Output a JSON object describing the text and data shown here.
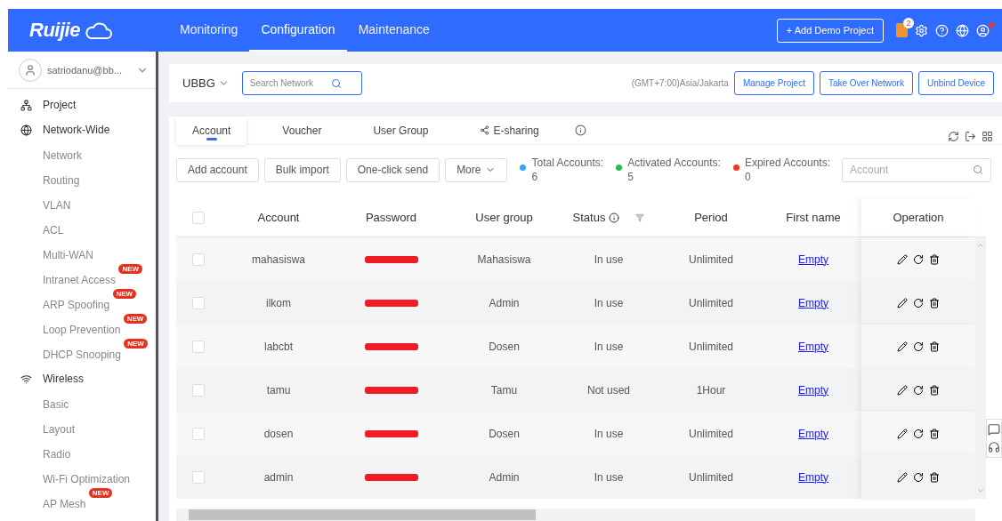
{
  "header": {
    "logo": "Ruijie",
    "nav": [
      {
        "label": "Monitoring",
        "selected": false
      },
      {
        "label": "Configuration",
        "selected": true
      },
      {
        "label": "Maintenance",
        "selected": false
      }
    ],
    "add_demo_button": "+ Add Demo Project",
    "alert_count": "2"
  },
  "user": {
    "name": "satriodanu@bb..."
  },
  "sidebar": {
    "items": [
      {
        "label": "Project",
        "kind": "project"
      },
      {
        "label": "Network-Wide",
        "kind": "globe",
        "children": [
          {
            "label": "Network"
          },
          {
            "label": "Routing"
          },
          {
            "label": "VLAN"
          },
          {
            "label": "ACL"
          },
          {
            "label": "Multi-WAN"
          },
          {
            "label": "Intranet Access",
            "badge": "NEW"
          },
          {
            "label": "ARP Spoofing",
            "badge": "NEW"
          },
          {
            "label": "Loop Prevention",
            "badge": "NEW"
          },
          {
            "label": "DHCP Snooping",
            "badge": "NEW"
          }
        ]
      },
      {
        "label": "Wireless",
        "kind": "wifi",
        "children": [
          {
            "label": "Basic"
          },
          {
            "label": "Layout"
          },
          {
            "label": "Radio"
          },
          {
            "label": "Wi-Fi Optimization"
          },
          {
            "label": "AP Mesh",
            "badge": "NEW"
          }
        ]
      }
    ]
  },
  "project_bar": {
    "network": "UBBG",
    "search": {
      "placeholder": "Search Network"
    },
    "timezone": "(GMT+7:00)Asia/Jakarta",
    "buttons": [
      "Manage Project",
      "Take Over Network",
      "Unbind Device"
    ]
  },
  "tabs": [
    {
      "label": "Account",
      "selected": true
    },
    {
      "label": "Voucher",
      "selected": false
    },
    {
      "label": "User Group",
      "selected": false
    },
    {
      "label": "E-sharing",
      "selected": false
    }
  ],
  "actions": [
    "Add account",
    "Bulk import",
    "One-click send",
    "More"
  ],
  "stats": [
    {
      "label": "Total Accounts:",
      "value": "6",
      "color": "#3aa0f5"
    },
    {
      "label": "Activated Accounts:",
      "value": "5",
      "color": "#1cbf4c"
    },
    {
      "label": "Expired Accounts:",
      "value": "0",
      "color": "#f5341a"
    }
  ],
  "account_search": {
    "placeholder": "Account"
  },
  "table": {
    "select_all_checked": false,
    "columns": [
      "Account",
      "Password",
      "User group",
      "Status",
      "Period",
      "First name",
      "Operation"
    ],
    "rows": [
      {
        "checked": false,
        "account": "mahasiswa",
        "user_group": "Mahasiswa",
        "status": "In use",
        "period": "Unlimited",
        "first_name": "Empty"
      },
      {
        "checked": false,
        "account": "ilkom",
        "user_group": "Admin",
        "status": "In use",
        "period": "Unlimited",
        "first_name": "Empty"
      },
      {
        "checked": false,
        "account": "labcbt",
        "user_group": "Dosen",
        "status": "In use",
        "period": "Unlimited",
        "first_name": "Empty"
      },
      {
        "checked": false,
        "account": "tamu",
        "user_group": "Tamu",
        "status": "Not used",
        "period": "1Hour",
        "first_name": "Empty"
      },
      {
        "checked": false,
        "account": "dosen",
        "user_group": "Dosen",
        "status": "In use",
        "period": "Unlimited",
        "first_name": "Empty"
      },
      {
        "checked": false,
        "account": "admin",
        "user_group": "Admin",
        "status": "In use",
        "period": "Unlimited",
        "first_name": "Empty"
      }
    ]
  }
}
